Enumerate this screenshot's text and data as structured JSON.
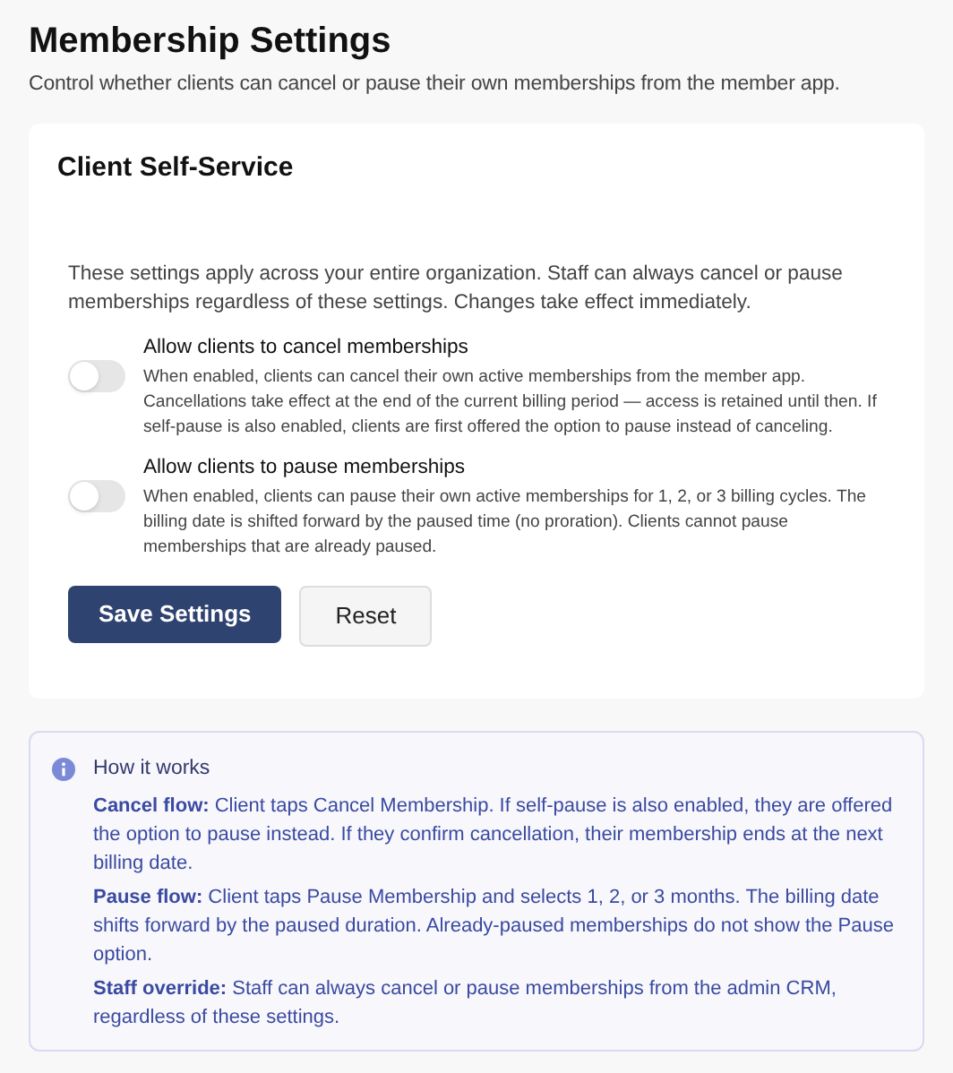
{
  "page": {
    "title": "Membership Settings",
    "subtitle": "Control whether clients can cancel or pause their own memberships from the member app."
  },
  "card": {
    "title": "Client Self-Service",
    "intro": "These settings apply across your entire organization. Staff can always cancel or pause memberships regardless of these settings. Changes take effect immediately.",
    "settings": [
      {
        "label": "Allow clients to cancel memberships",
        "on": false,
        "description": "When enabled, clients can cancel their own active memberships from the member app. Cancellations take effect at the end of the current billing period — access is retained until then. If self-pause is also enabled, clients are first offered the option to pause instead of canceling."
      },
      {
        "label": "Allow clients to pause memberships",
        "on": false,
        "description": "When enabled, clients can pause their own active memberships for 1, 2, or 3 billing cycles. The billing date is shifted forward by the paused time (no proration). Clients cannot pause memberships that are already paused."
      }
    ],
    "buttons": [
      {
        "label": "Save Settings",
        "kind": "primary"
      },
      {
        "label": "Reset",
        "kind": "secondary"
      }
    ]
  },
  "info": {
    "title": "How it works",
    "items": [
      {
        "text": "**Cancel flow:** Client taps Cancel Membership. If self-pause is also enabled, they are offered the option to pause instead. If they confirm cancellation, their membership ends at the next billing date."
      },
      {
        "text": "**Pause flow:** Client taps Pause Membership and selects 1, 2, or 3 months. The billing date shifts forward by the paused duration. Already-paused memberships do not show the Pause option."
      },
      {
        "text": "**Staff override:** Staff can always cancel or pause memberships from the admin CRM, regardless of these settings."
      }
    ]
  }
}
